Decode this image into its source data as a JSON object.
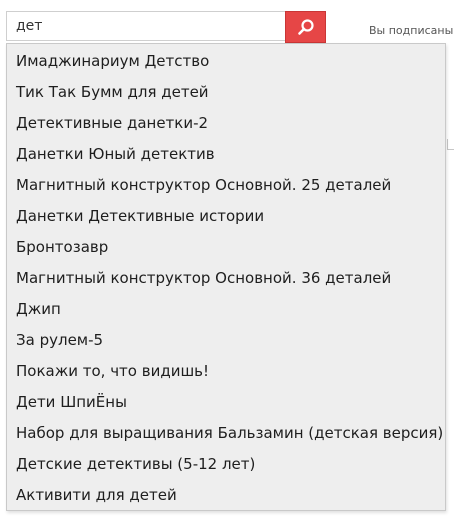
{
  "search": {
    "value": "дет",
    "button_icon": "search-icon",
    "button_color": "#e64646"
  },
  "background": {
    "subscribed_text": "Вы подписаны. О"
  },
  "suggestions": [
    "Имаджинариум Детство",
    "Тик Так Бумм для детей",
    "Детективные данетки-2",
    "Данетки Юный детектив",
    "Магнитный конструктор Основной. 25 деталей",
    "Данетки Детективные истории",
    "Бронтозавр",
    "Магнитный конструктор Основной. 36 деталей",
    "Джип",
    "За рулем-5",
    "Покажи то, что видишь!",
    "Дети ШпиЁны",
    "Набор для выращивания Бальзамин (детская версия)",
    "Детские детективы (5-12 лет)",
    "Активити для детей"
  ]
}
